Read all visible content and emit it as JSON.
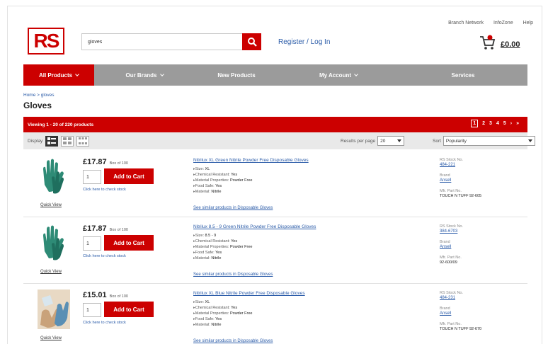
{
  "header": {
    "top_links": [
      "Branch Network",
      "InfoZone",
      "Help"
    ],
    "logo_text": "RS",
    "search": {
      "value": "gloves",
      "placeholder": ""
    },
    "login_link": "Register / Log In",
    "cart_total": "£0.00"
  },
  "nav": {
    "items": [
      "All Products",
      "Our Brands",
      "New Products",
      "My Account",
      "Services"
    ]
  },
  "breadcrumb": "Home > gloves",
  "page_title": "Gloves",
  "results": {
    "summary": "Viewing 1 - 20 of 220 products",
    "pages": [
      "1",
      "2",
      "3",
      "4",
      "5",
      "›",
      "»"
    ]
  },
  "toolbar": {
    "display_label": "Display",
    "results_per_page_label": "Results per page",
    "results_per_page_value": "20",
    "sort_label": "Sort",
    "sort_value": "Popularity"
  },
  "products": [
    {
      "price": "£17.87",
      "price_unit": "Box of 100",
      "qty": "1",
      "add_label": "Add to Cart",
      "stock_link": "Click here to check stock",
      "quick_view": "Quick View",
      "name": "Nitrilux XL Green Nitrile Powder Free Disposable Gloves",
      "specs": [
        {
          "k": "Size:",
          "v": "XL"
        },
        {
          "k": "Chemical Resistant:",
          "v": "Yes"
        },
        {
          "k": "Material Properties:",
          "v": "Powder Free"
        },
        {
          "k": "Food Safe:",
          "v": "Yes"
        },
        {
          "k": "Material:",
          "v": "Nitrile"
        }
      ],
      "similar_link": "See similar products in Disposable Gloves",
      "stock_no_label": "RS Stock No.",
      "stock_no": "484-221",
      "brand_label": "Brand",
      "brand": "Ansell",
      "mfr_label": "Mfr. Part No.",
      "mfr": "TOUCH N TUFF 92-605"
    },
    {
      "price": "£17.87",
      "price_unit": "Box of 100",
      "qty": "1",
      "add_label": "Add to Cart",
      "stock_link": "Click here to check stock",
      "quick_view": "Quick View",
      "name": "Nitrilux 8.5 - 9 Green Nitrile Powder Free Disposable Gloves",
      "specs": [
        {
          "k": "Size:",
          "v": "8.5 - 9"
        },
        {
          "k": "Chemical Resistant:",
          "v": "Yes"
        },
        {
          "k": "Material Properties:",
          "v": "Powder Free"
        },
        {
          "k": "Food Safe:",
          "v": "Yes"
        },
        {
          "k": "Material:",
          "v": "Nitrile"
        }
      ],
      "similar_link": "See similar products in Disposable Gloves",
      "stock_no_label": "RS Stock No.",
      "stock_no": "384-6703",
      "brand_label": "Brand",
      "brand": "Ansell",
      "mfr_label": "Mfr. Part No.",
      "mfr": "92-600/09"
    },
    {
      "price": "£15.01",
      "price_unit": "Box of 100",
      "qty": "1",
      "add_label": "Add to Cart",
      "stock_link": "Click here to check stock",
      "quick_view": "Quick View",
      "name": "Nitrilux XL Blue Nitrile Powder Free Disposable Gloves",
      "specs": [
        {
          "k": "Size:",
          "v": "XL"
        },
        {
          "k": "Chemical Resistant:",
          "v": "Yes"
        },
        {
          "k": "Material Properties:",
          "v": "Powder Free"
        },
        {
          "k": "Food Safe:",
          "v": "Yes"
        },
        {
          "k": "Material:",
          "v": "Nitrile"
        }
      ],
      "similar_link": "See similar products in Disposable Gloves",
      "stock_no_label": "RS Stock No.",
      "stock_no": "484-231",
      "brand_label": "Brand",
      "brand": "Ansell",
      "mfr_label": "Mfr. Part No.",
      "mfr": "TOUCH N TUFF 92-670"
    }
  ],
  "colors": {
    "brand_red": "#cc0000",
    "nav_grey": "#9b9b9b",
    "link_blue": "#2a5ba8"
  }
}
